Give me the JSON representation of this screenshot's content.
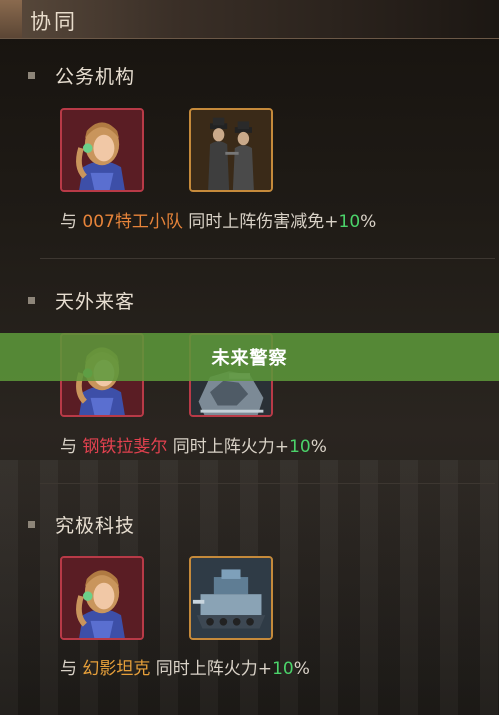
{
  "header": {
    "title": "协同"
  },
  "sections": [
    {
      "title": "公务机构",
      "desc": {
        "prefix": "与 ",
        "partner": "007特工小队",
        "middle": " 同时上阵伤害减免+",
        "value": "10",
        "suffix": "%"
      }
    },
    {
      "title": "天外来客",
      "desc": {
        "prefix": "与 ",
        "partner": "钢铁拉斐尔",
        "middle": " 同时上阵火力+",
        "value": "10",
        "suffix": "%"
      }
    },
    {
      "title": "究极科技",
      "desc": {
        "prefix": "与 ",
        "partner": "幻影坦克",
        "middle": " 同时上阵火力+",
        "value": "10",
        "suffix": "%"
      }
    }
  ],
  "toast": {
    "text": "未来警察"
  },
  "colors": {
    "partner_orange": "#e7843a",
    "partner_red": "#e2414f",
    "partner_gold": "#e7a03a",
    "bonus_green": "#4bd36a",
    "toast_bg": "#5c963a"
  }
}
